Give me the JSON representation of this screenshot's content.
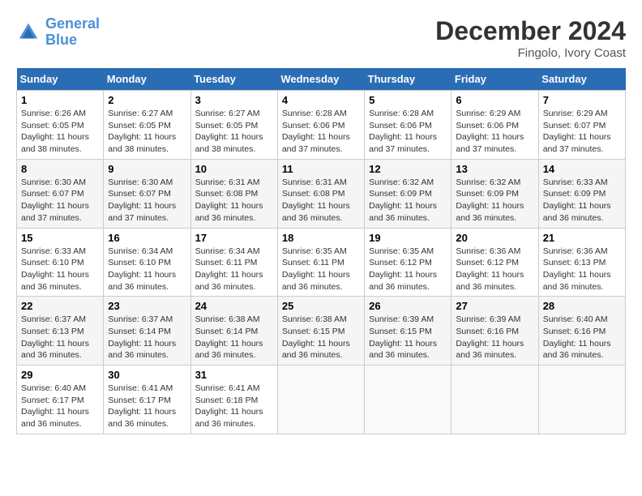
{
  "header": {
    "logo_line1": "General",
    "logo_line2": "Blue",
    "month": "December 2024",
    "location": "Fingolo, Ivory Coast"
  },
  "weekdays": [
    "Sunday",
    "Monday",
    "Tuesday",
    "Wednesday",
    "Thursday",
    "Friday",
    "Saturday"
  ],
  "weeks": [
    [
      {
        "day": "1",
        "sunrise": "6:26 AM",
        "sunset": "6:05 PM",
        "daylight": "11 hours and 38 minutes."
      },
      {
        "day": "2",
        "sunrise": "6:27 AM",
        "sunset": "6:05 PM",
        "daylight": "11 hours and 38 minutes."
      },
      {
        "day": "3",
        "sunrise": "6:27 AM",
        "sunset": "6:05 PM",
        "daylight": "11 hours and 38 minutes."
      },
      {
        "day": "4",
        "sunrise": "6:28 AM",
        "sunset": "6:06 PM",
        "daylight": "11 hours and 37 minutes."
      },
      {
        "day": "5",
        "sunrise": "6:28 AM",
        "sunset": "6:06 PM",
        "daylight": "11 hours and 37 minutes."
      },
      {
        "day": "6",
        "sunrise": "6:29 AM",
        "sunset": "6:06 PM",
        "daylight": "11 hours and 37 minutes."
      },
      {
        "day": "7",
        "sunrise": "6:29 AM",
        "sunset": "6:07 PM",
        "daylight": "11 hours and 37 minutes."
      }
    ],
    [
      {
        "day": "8",
        "sunrise": "6:30 AM",
        "sunset": "6:07 PM",
        "daylight": "11 hours and 37 minutes."
      },
      {
        "day": "9",
        "sunrise": "6:30 AM",
        "sunset": "6:07 PM",
        "daylight": "11 hours and 37 minutes."
      },
      {
        "day": "10",
        "sunrise": "6:31 AM",
        "sunset": "6:08 PM",
        "daylight": "11 hours and 36 minutes."
      },
      {
        "day": "11",
        "sunrise": "6:31 AM",
        "sunset": "6:08 PM",
        "daylight": "11 hours and 36 minutes."
      },
      {
        "day": "12",
        "sunrise": "6:32 AM",
        "sunset": "6:09 PM",
        "daylight": "11 hours and 36 minutes."
      },
      {
        "day": "13",
        "sunrise": "6:32 AM",
        "sunset": "6:09 PM",
        "daylight": "11 hours and 36 minutes."
      },
      {
        "day": "14",
        "sunrise": "6:33 AM",
        "sunset": "6:09 PM",
        "daylight": "11 hours and 36 minutes."
      }
    ],
    [
      {
        "day": "15",
        "sunrise": "6:33 AM",
        "sunset": "6:10 PM",
        "daylight": "11 hours and 36 minutes."
      },
      {
        "day": "16",
        "sunrise": "6:34 AM",
        "sunset": "6:10 PM",
        "daylight": "11 hours and 36 minutes."
      },
      {
        "day": "17",
        "sunrise": "6:34 AM",
        "sunset": "6:11 PM",
        "daylight": "11 hours and 36 minutes."
      },
      {
        "day": "18",
        "sunrise": "6:35 AM",
        "sunset": "6:11 PM",
        "daylight": "11 hours and 36 minutes."
      },
      {
        "day": "19",
        "sunrise": "6:35 AM",
        "sunset": "6:12 PM",
        "daylight": "11 hours and 36 minutes."
      },
      {
        "day": "20",
        "sunrise": "6:36 AM",
        "sunset": "6:12 PM",
        "daylight": "11 hours and 36 minutes."
      },
      {
        "day": "21",
        "sunrise": "6:36 AM",
        "sunset": "6:13 PM",
        "daylight": "11 hours and 36 minutes."
      }
    ],
    [
      {
        "day": "22",
        "sunrise": "6:37 AM",
        "sunset": "6:13 PM",
        "daylight": "11 hours and 36 minutes."
      },
      {
        "day": "23",
        "sunrise": "6:37 AM",
        "sunset": "6:14 PM",
        "daylight": "11 hours and 36 minutes."
      },
      {
        "day": "24",
        "sunrise": "6:38 AM",
        "sunset": "6:14 PM",
        "daylight": "11 hours and 36 minutes."
      },
      {
        "day": "25",
        "sunrise": "6:38 AM",
        "sunset": "6:15 PM",
        "daylight": "11 hours and 36 minutes."
      },
      {
        "day": "26",
        "sunrise": "6:39 AM",
        "sunset": "6:15 PM",
        "daylight": "11 hours and 36 minutes."
      },
      {
        "day": "27",
        "sunrise": "6:39 AM",
        "sunset": "6:16 PM",
        "daylight": "11 hours and 36 minutes."
      },
      {
        "day": "28",
        "sunrise": "6:40 AM",
        "sunset": "6:16 PM",
        "daylight": "11 hours and 36 minutes."
      }
    ],
    [
      {
        "day": "29",
        "sunrise": "6:40 AM",
        "sunset": "6:17 PM",
        "daylight": "11 hours and 36 minutes."
      },
      {
        "day": "30",
        "sunrise": "6:41 AM",
        "sunset": "6:17 PM",
        "daylight": "11 hours and 36 minutes."
      },
      {
        "day": "31",
        "sunrise": "6:41 AM",
        "sunset": "6:18 PM",
        "daylight": "11 hours and 36 minutes."
      },
      null,
      null,
      null,
      null
    ]
  ]
}
